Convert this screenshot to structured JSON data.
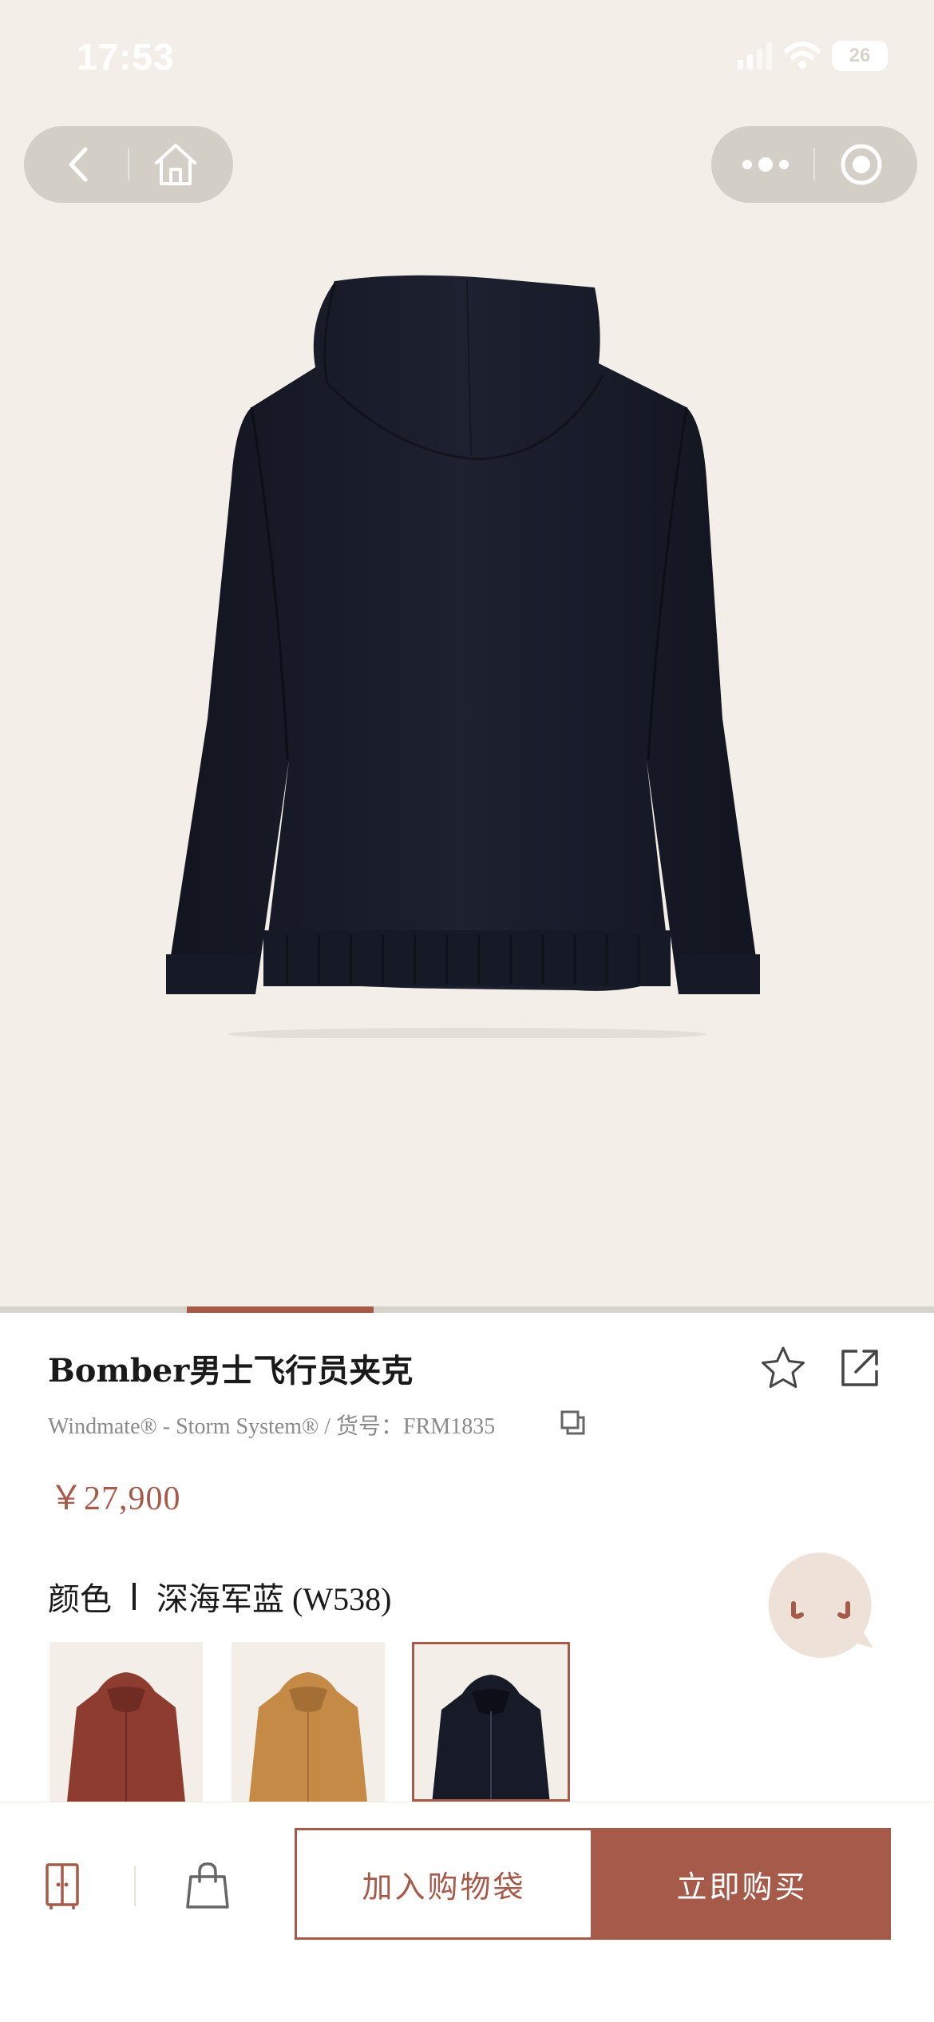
{
  "status_bar": {
    "time": "17:53",
    "battery": "26"
  },
  "product": {
    "title": "Bomber男士飞行员夹克",
    "subtitle": "Windmate® - Storm System® / 货号：FRM1835",
    "price": "￥27,900",
    "color_label": "颜色",
    "color_value": "深海军蓝 (W538)",
    "image_progress": 0.2
  },
  "swatches": [
    {
      "name": "red",
      "color": "#8d3c2f"
    },
    {
      "name": "tan",
      "color": "#c48a46"
    },
    {
      "name": "navy",
      "color": "#171b28",
      "selected": true
    }
  ],
  "actions": {
    "add_to_bag": "加入购物袋",
    "buy_now": "立即购买"
  },
  "colors": {
    "accent": "#a65a4a",
    "background": "#f3efe8",
    "product": "#171b28"
  }
}
